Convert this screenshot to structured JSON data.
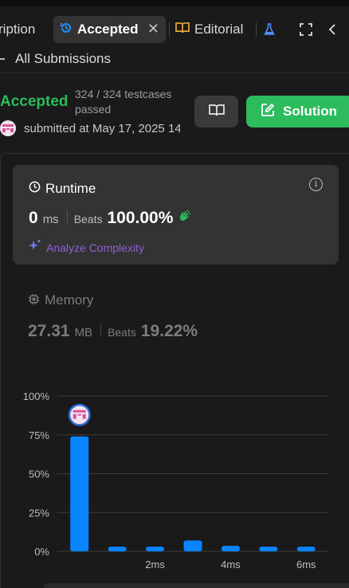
{
  "tabs": {
    "description_label": "ription",
    "accepted_label": "Accepted",
    "editorial_label": "Editorial"
  },
  "nav": {
    "all_submissions": "All Submissions"
  },
  "submission": {
    "status": "Accepted",
    "passed_text": "324 / 324 testcases passed",
    "submitted_text": "submitted at May 17, 2025 14"
  },
  "buttons": {
    "solution_label": "Solution"
  },
  "runtime": {
    "title": "Runtime",
    "value": "0",
    "unit": "ms",
    "beats_label": "Beats",
    "beats_pct": "100.00%",
    "analyze_label": "Analyze Complexity"
  },
  "memory": {
    "title": "Memory",
    "value": "27.31",
    "unit": "MB",
    "beats_label": "Beats",
    "beats_pct": "19.22%"
  },
  "colors": {
    "accent_green": "#2cbb5d",
    "bar_blue": "#0a84ff",
    "analyze_purple": "#8a63d2"
  },
  "chart_data": {
    "type": "bar",
    "categories": [
      "0ms",
      "1ms",
      "2ms",
      "3ms",
      "4ms",
      "5ms",
      "6ms"
    ],
    "values": [
      74,
      3,
      3,
      7,
      3.5,
      3,
      3
    ],
    "ylim": [
      0,
      100
    ],
    "yticks": [
      "0%",
      "25%",
      "50%",
      "75%",
      "100%"
    ],
    "xtick_labels": [
      "2ms",
      "4ms",
      "6ms"
    ],
    "grid": true,
    "highlight_index": 0
  }
}
